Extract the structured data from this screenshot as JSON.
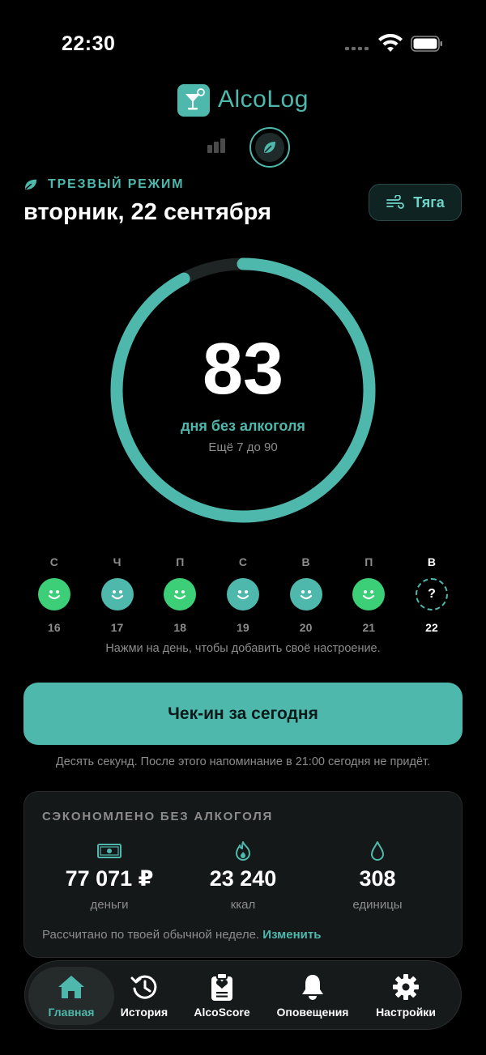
{
  "status_bar": {
    "time": "22:30"
  },
  "app": {
    "name": "AlcoLog"
  },
  "header": {
    "mode_label": "ТРЕЗВЫЙ РЕЖИМ",
    "date": "вторник, 22 сентября",
    "craving_button": "Тяга"
  },
  "progress": {
    "days": "83",
    "label": "дня без алкоголя",
    "remaining": "Ещё 7 до 90",
    "goal_days": 90,
    "current_days": 83
  },
  "week": {
    "days": [
      {
        "letter": "С",
        "number": "16",
        "mood": "green"
      },
      {
        "letter": "Ч",
        "number": "17",
        "mood": "teal"
      },
      {
        "letter": "П",
        "number": "18",
        "mood": "green"
      },
      {
        "letter": "С",
        "number": "19",
        "mood": "teal"
      },
      {
        "letter": "В",
        "number": "20",
        "mood": "teal"
      },
      {
        "letter": "П",
        "number": "21",
        "mood": "green"
      },
      {
        "letter": "В",
        "number": "22",
        "mood": "unknown",
        "symbol": "?"
      }
    ],
    "hint": "Нажми на день, чтобы добавить своё настроение."
  },
  "checkin": {
    "button": "Чек-ин за сегодня",
    "note": "Десять секунд. После этого напоминание в 21:00 сегодня не придёт."
  },
  "savings": {
    "title": "СЭКОНОМЛЕНО БЕЗ АЛКОГОЛЯ",
    "stats": [
      {
        "value": "77 071 ₽",
        "label": "деньги",
        "icon": "money-icon"
      },
      {
        "value": "23 240",
        "label": "ккал",
        "icon": "flame-icon"
      },
      {
        "value": "308",
        "label": "единицы",
        "icon": "drop-icon"
      }
    ],
    "footer": "Рассчитано по твоей обычной неделе.",
    "footer_link": "Изменить"
  },
  "tabs": [
    {
      "label": "Главная",
      "icon": "home-icon",
      "active": true
    },
    {
      "label": "История",
      "icon": "history-icon"
    },
    {
      "label": "AlcoScore",
      "icon": "clipboard-heart-icon"
    },
    {
      "label": "Оповещения",
      "icon": "bell-icon"
    },
    {
      "label": "Настройки",
      "icon": "gear-icon"
    }
  ],
  "colors": {
    "accent": "#4fb8ad",
    "mood_green": "#3dcf78",
    "background": "#000000"
  }
}
